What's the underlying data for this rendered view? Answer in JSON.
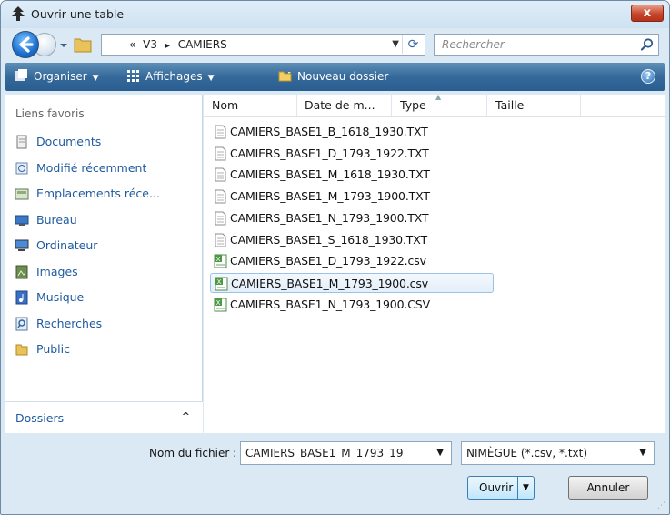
{
  "window": {
    "title": "Ouvrir une table",
    "close_label": "x"
  },
  "address": {
    "path_prefix": "«",
    "crumb_1": "V3",
    "separator": "▸",
    "crumb_2": "CAMIERS",
    "search_placeholder": "Rechercher"
  },
  "toolbar": {
    "organise": "Organiser",
    "views": "Affichages",
    "new_folder": "Nouveau dossier",
    "help": "?"
  },
  "favorites": {
    "title": "Liens favoris",
    "items": [
      {
        "label": "Documents",
        "icon": "documents-icon"
      },
      {
        "label": "Modifié récemment",
        "icon": "recent-icon"
      },
      {
        "label": "Emplacements réce...",
        "icon": "recent-places-icon"
      },
      {
        "label": "Bureau",
        "icon": "desktop-icon"
      },
      {
        "label": "Ordinateur",
        "icon": "computer-icon"
      },
      {
        "label": "Images",
        "icon": "pictures-icon"
      },
      {
        "label": "Musique",
        "icon": "music-icon"
      },
      {
        "label": "Recherches",
        "icon": "searches-icon"
      },
      {
        "label": "Public",
        "icon": "public-folder-icon"
      }
    ],
    "folders_label": "Dossiers",
    "folders_chevron": "^"
  },
  "columns": [
    "Nom",
    "Date de m...",
    "Type",
    "Taille"
  ],
  "files": [
    {
      "name": "CAMIERS_BASE1_B_1618_1930.TXT",
      "kind": "txt"
    },
    {
      "name": "CAMIERS_BASE1_D_1793_1922.TXT",
      "kind": "txt"
    },
    {
      "name": "CAMIERS_BASE1_M_1618_1930.TXT",
      "kind": "txt"
    },
    {
      "name": "CAMIERS_BASE1_M_1793_1900.TXT",
      "kind": "txt"
    },
    {
      "name": "CAMIERS_BASE1_N_1793_1900.TXT",
      "kind": "txt"
    },
    {
      "name": "CAMIERS_BASE1_S_1618_1930.TXT",
      "kind": "txt"
    },
    {
      "name": "CAMIERS_BASE1_D_1793_1922.csv",
      "kind": "csv"
    },
    {
      "name": "CAMIERS_BASE1_M_1793_1900.csv",
      "kind": "csv",
      "selected": true
    },
    {
      "name": "CAMIERS_BASE1_N_1793_1900.CSV",
      "kind": "csv"
    }
  ],
  "bottom": {
    "filename_label": "Nom du fichier :",
    "filename_value": "CAMIERS_BASE1_M_1793_19",
    "filter_value": "NIMÈGUE (*.csv, *.txt)",
    "open_label": "Ouvrir",
    "cancel_label": "Annuler"
  },
  "colors": {
    "toolbar": "#35699a",
    "link": "#1e5a9e",
    "close": "#c6472c",
    "selection_border": "#9ac2e8"
  }
}
